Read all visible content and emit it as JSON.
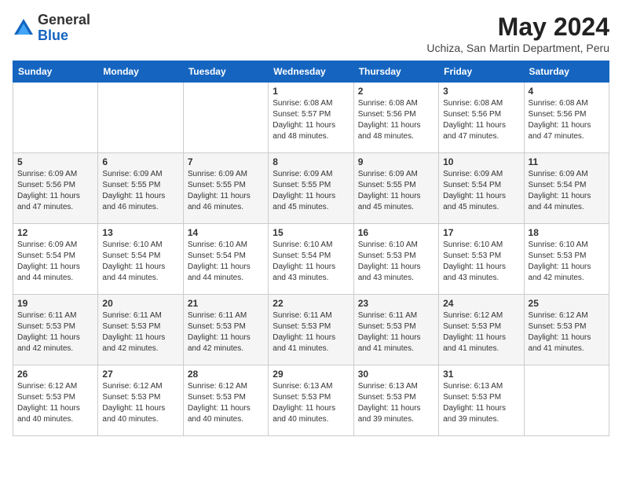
{
  "logo": {
    "general": "General",
    "blue": "Blue"
  },
  "header": {
    "month_year": "May 2024",
    "location": "Uchiza, San Martin Department, Peru"
  },
  "days_of_week": [
    "Sunday",
    "Monday",
    "Tuesday",
    "Wednesday",
    "Thursday",
    "Friday",
    "Saturday"
  ],
  "weeks": [
    [
      {
        "day": "",
        "info": ""
      },
      {
        "day": "",
        "info": ""
      },
      {
        "day": "",
        "info": ""
      },
      {
        "day": "1",
        "info": "Sunrise: 6:08 AM\nSunset: 5:57 PM\nDaylight: 11 hours and 48 minutes."
      },
      {
        "day": "2",
        "info": "Sunrise: 6:08 AM\nSunset: 5:56 PM\nDaylight: 11 hours and 48 minutes."
      },
      {
        "day": "3",
        "info": "Sunrise: 6:08 AM\nSunset: 5:56 PM\nDaylight: 11 hours and 47 minutes."
      },
      {
        "day": "4",
        "info": "Sunrise: 6:08 AM\nSunset: 5:56 PM\nDaylight: 11 hours and 47 minutes."
      }
    ],
    [
      {
        "day": "5",
        "info": "Sunrise: 6:09 AM\nSunset: 5:56 PM\nDaylight: 11 hours and 47 minutes."
      },
      {
        "day": "6",
        "info": "Sunrise: 6:09 AM\nSunset: 5:55 PM\nDaylight: 11 hours and 46 minutes."
      },
      {
        "day": "7",
        "info": "Sunrise: 6:09 AM\nSunset: 5:55 PM\nDaylight: 11 hours and 46 minutes."
      },
      {
        "day": "8",
        "info": "Sunrise: 6:09 AM\nSunset: 5:55 PM\nDaylight: 11 hours and 45 minutes."
      },
      {
        "day": "9",
        "info": "Sunrise: 6:09 AM\nSunset: 5:55 PM\nDaylight: 11 hours and 45 minutes."
      },
      {
        "day": "10",
        "info": "Sunrise: 6:09 AM\nSunset: 5:54 PM\nDaylight: 11 hours and 45 minutes."
      },
      {
        "day": "11",
        "info": "Sunrise: 6:09 AM\nSunset: 5:54 PM\nDaylight: 11 hours and 44 minutes."
      }
    ],
    [
      {
        "day": "12",
        "info": "Sunrise: 6:09 AM\nSunset: 5:54 PM\nDaylight: 11 hours and 44 minutes."
      },
      {
        "day": "13",
        "info": "Sunrise: 6:10 AM\nSunset: 5:54 PM\nDaylight: 11 hours and 44 minutes."
      },
      {
        "day": "14",
        "info": "Sunrise: 6:10 AM\nSunset: 5:54 PM\nDaylight: 11 hours and 44 minutes."
      },
      {
        "day": "15",
        "info": "Sunrise: 6:10 AM\nSunset: 5:54 PM\nDaylight: 11 hours and 43 minutes."
      },
      {
        "day": "16",
        "info": "Sunrise: 6:10 AM\nSunset: 5:53 PM\nDaylight: 11 hours and 43 minutes."
      },
      {
        "day": "17",
        "info": "Sunrise: 6:10 AM\nSunset: 5:53 PM\nDaylight: 11 hours and 43 minutes."
      },
      {
        "day": "18",
        "info": "Sunrise: 6:10 AM\nSunset: 5:53 PM\nDaylight: 11 hours and 42 minutes."
      }
    ],
    [
      {
        "day": "19",
        "info": "Sunrise: 6:11 AM\nSunset: 5:53 PM\nDaylight: 11 hours and 42 minutes."
      },
      {
        "day": "20",
        "info": "Sunrise: 6:11 AM\nSunset: 5:53 PM\nDaylight: 11 hours and 42 minutes."
      },
      {
        "day": "21",
        "info": "Sunrise: 6:11 AM\nSunset: 5:53 PM\nDaylight: 11 hours and 42 minutes."
      },
      {
        "day": "22",
        "info": "Sunrise: 6:11 AM\nSunset: 5:53 PM\nDaylight: 11 hours and 41 minutes."
      },
      {
        "day": "23",
        "info": "Sunrise: 6:11 AM\nSunset: 5:53 PM\nDaylight: 11 hours and 41 minutes."
      },
      {
        "day": "24",
        "info": "Sunrise: 6:12 AM\nSunset: 5:53 PM\nDaylight: 11 hours and 41 minutes."
      },
      {
        "day": "25",
        "info": "Sunrise: 6:12 AM\nSunset: 5:53 PM\nDaylight: 11 hours and 41 minutes."
      }
    ],
    [
      {
        "day": "26",
        "info": "Sunrise: 6:12 AM\nSunset: 5:53 PM\nDaylight: 11 hours and 40 minutes."
      },
      {
        "day": "27",
        "info": "Sunrise: 6:12 AM\nSunset: 5:53 PM\nDaylight: 11 hours and 40 minutes."
      },
      {
        "day": "28",
        "info": "Sunrise: 6:12 AM\nSunset: 5:53 PM\nDaylight: 11 hours and 40 minutes."
      },
      {
        "day": "29",
        "info": "Sunrise: 6:13 AM\nSunset: 5:53 PM\nDaylight: 11 hours and 40 minutes."
      },
      {
        "day": "30",
        "info": "Sunrise: 6:13 AM\nSunset: 5:53 PM\nDaylight: 11 hours and 39 minutes."
      },
      {
        "day": "31",
        "info": "Sunrise: 6:13 AM\nSunset: 5:53 PM\nDaylight: 11 hours and 39 minutes."
      },
      {
        "day": "",
        "info": ""
      }
    ]
  ]
}
